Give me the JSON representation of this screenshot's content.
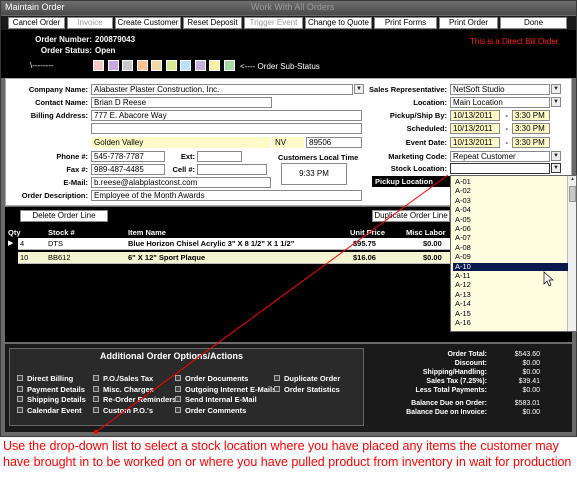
{
  "window": {
    "title": "Maintain Order",
    "center_title": "Work With All Orders"
  },
  "toolbar": {
    "buttons": [
      {
        "label": "Cancel Order",
        "enabled": true
      },
      {
        "label": "Invoice",
        "enabled": false
      },
      {
        "label": "Create Customer",
        "enabled": true
      },
      {
        "label": "Reset Deposit",
        "enabled": true
      },
      {
        "label": "Trigger Event",
        "enabled": false
      },
      {
        "label": "Change to Quote",
        "enabled": true
      },
      {
        "label": "Print Forms",
        "enabled": true
      },
      {
        "label": "Print Order",
        "enabled": true
      },
      {
        "label": "Done",
        "enabled": true
      }
    ]
  },
  "header": {
    "order_number_label": "Order Number:",
    "order_number": "200879043",
    "order_status_label": "Order Status:",
    "order_status": "Open",
    "direct_bill": "This is a Direct Bill Order",
    "substatus_arrow": "\\--------",
    "substatus_label": "<---- Order Sub-Status",
    "substatus_colors": [
      "#f2c6c6",
      "#c8a8e0",
      "#c8c8c8",
      "#ffc090",
      "#f0d8a8",
      "#d8e890",
      "#b8e0f8",
      "#c8b0d8",
      "#f8f0a0",
      "#a8d8a8"
    ]
  },
  "customer": {
    "company_label": "Company Name:",
    "company": "Alabaster Plaster Construction, Inc.",
    "contact_label": "Contact Name:",
    "contact": "Brian D Reese",
    "billing_label": "Billing Address:",
    "address1": "777 E. Abacore Way",
    "address2": "",
    "city": "Golden Valley",
    "state": "NV",
    "zip": "89506",
    "phone_label": "Phone #:",
    "phone": "545-778-7787",
    "ext_label": "Ext:",
    "fax_label": "Fax #:",
    "fax": "989-487-4485",
    "cell_label": "Cell #:",
    "email_label": "E-Mail:",
    "email": "b.reese@alabplastconst.com",
    "desc_label": "Order Description:",
    "description": "Employee of the Month Awards",
    "local_time_label": "Customers Local Time",
    "local_time": "9:33 PM"
  },
  "order_info": {
    "sales_rep_label": "Sales Representative:",
    "sales_rep": "NetSoft Studio",
    "location_label": "Location:",
    "location": "Main Location",
    "pickup_label": "Pickup/Ship By:",
    "pickup_date": "10/13/2011",
    "pickup_time": "3:30 PM",
    "scheduled_label": "Scheduled:",
    "scheduled_date": "10/13/2011",
    "scheduled_time": "3:30 PM",
    "event_label": "Event Date:",
    "event_date": "10/13/2011",
    "event_time": "3:30 PM",
    "marketing_label": "Marketing Code:",
    "marketing": "Repeat Customer",
    "stock_label": "Stock Location:",
    "stock": "",
    "pickup_location_label": "Pickup Location",
    "dash": "-"
  },
  "grid": {
    "delete_label": "Delete Order Line",
    "duplicate_label": "Duplicate Order Line",
    "columns": [
      "Qty",
      "Stock #",
      "Item Name",
      "Unit Price",
      "Misc Labor"
    ],
    "rows": [
      {
        "qty": "4",
        "stock": "DTS",
        "item": "Blue Horizon Chisel Acrylic 3\" X 8 1/2\" X 1 1/2\"",
        "price": "$95.75",
        "labor": "$0.00"
      },
      {
        "qty": "10",
        "stock": "BB612",
        "item": "6\" X 12\" Sport Plaque",
        "price": "$16.06",
        "labor": "$0.00"
      }
    ]
  },
  "dropdown": {
    "items": [
      "A-01",
      "A-02",
      "A-03",
      "A-04",
      "A-05",
      "A-06",
      "A-07",
      "A-08",
      "A-09",
      "A-10",
      "A-11",
      "A-12",
      "A-13",
      "A-14",
      "A-15",
      "A-16"
    ],
    "selected": "A-10"
  },
  "additional": {
    "title": "Additional Order Options/Actions",
    "col1": [
      "Direct Billing",
      "Payment Details",
      "Shipping Details",
      "Calendar Event"
    ],
    "col2": [
      "P.O./Sales Tax",
      "Misc. Charges",
      "Re-Order Reminders",
      "Custom P.O.'s"
    ],
    "col3": [
      "Order Documents",
      "Outgoing Internet E-Mails",
      "Send Internal E-Mail",
      "Order Comments"
    ],
    "col4": [
      "Duplicate Order",
      "Order Statistics"
    ]
  },
  "totals": {
    "rows": [
      {
        "label": "Order Total:",
        "value": "$543.60"
      },
      {
        "label": "Discount:",
        "value": "$0.00"
      },
      {
        "label": "Shipping/Handling:",
        "value": "$0.00"
      },
      {
        "label": "Sales Tax (7.25%):",
        "value": "$39.41"
      },
      {
        "label": "Less Total Payments:",
        "value": "$0.00"
      },
      {
        "label": "Balance Due on Order:",
        "value": "$583.01"
      },
      {
        "label": "Balance Due on Invoice:",
        "value": "$0.00"
      }
    ]
  },
  "caption": "Use the drop-down list to select a stock location where you have placed any items the customer may have brought in to be worked on or where you have pulled product from inventory in wait for production"
}
